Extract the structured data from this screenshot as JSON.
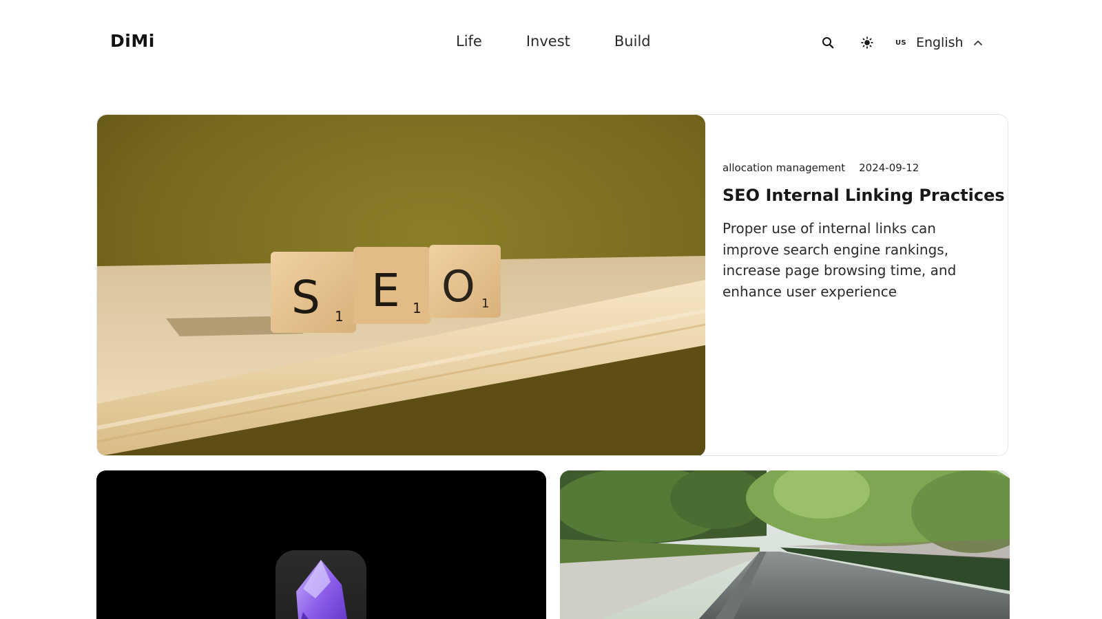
{
  "header": {
    "logo": "DiMi",
    "nav": [
      {
        "label": "Life"
      },
      {
        "label": "Invest"
      },
      {
        "label": "Build"
      }
    ],
    "search_icon": "search-icon",
    "theme_icon": "sun-icon",
    "language": {
      "flag": "US",
      "label": "English",
      "icon": "chevron-up-icon"
    }
  },
  "featured": {
    "category": "allocation management",
    "date": "2024-09-12",
    "title": "SEO Internal Linking Practices",
    "description": "Proper use of internal links can improve search engine rankings, increase page browsing time, and enhance user experience",
    "image": {
      "tiles": [
        {
          "letter": "S",
          "score": "1"
        },
        {
          "letter": "E",
          "score": "1"
        },
        {
          "letter": "O",
          "score": "1"
        }
      ]
    }
  },
  "cards": [
    {
      "image": "obsidian-app-icon"
    },
    {
      "image": "rainy-tree-lined-road-photo"
    }
  ],
  "colors": {
    "accent_purple": "#7b4fd6",
    "olive_bg": "#7c7222",
    "wood": "#e8cfa4"
  }
}
